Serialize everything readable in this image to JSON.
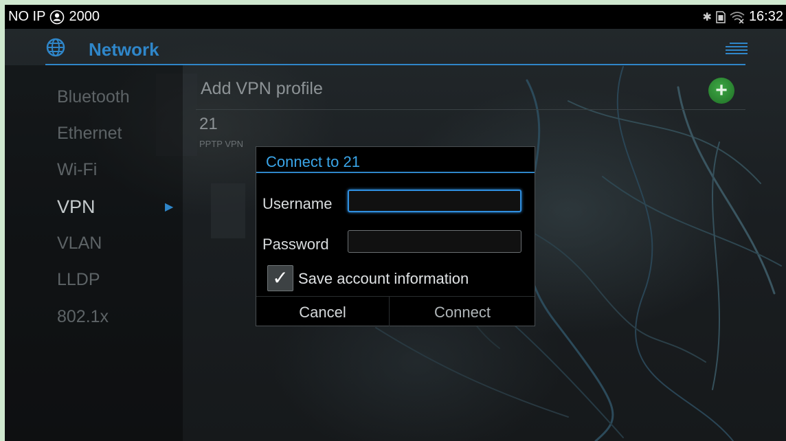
{
  "status_bar": {
    "ip_label": "NO IP",
    "account_number": "2000",
    "time": "16:32",
    "icons": [
      "person-circle-icon",
      "bluetooth-icon",
      "sim-icon",
      "wifi-off-icon"
    ]
  },
  "header": {
    "title": "Network",
    "logo_icon": "network-globe-icon",
    "menu_icon": "menu-icon",
    "accent_color": "#2f86c9"
  },
  "sidebar": {
    "items": [
      {
        "label": "Bluetooth"
      },
      {
        "label": "Ethernet"
      },
      {
        "label": "Wi-Fi"
      },
      {
        "label": "VPN",
        "active": true
      },
      {
        "label": "VLAN"
      },
      {
        "label": "LLDP"
      },
      {
        "label": "802.1x"
      }
    ],
    "active_arrow": "▶"
  },
  "content": {
    "add_vpn_label": "Add VPN profile",
    "add_button_icon": "plus-icon",
    "add_button_symbol": "+",
    "vpn_profiles": [
      {
        "name": "21",
        "type": "PPTP VPN"
      }
    ]
  },
  "dialog": {
    "title": "Connect to 21",
    "username_label": "Username",
    "username_value": "",
    "password_label": "Password",
    "password_value": "",
    "save_checkbox_checked": true,
    "save_label": "Save account information",
    "check_symbol": "✓",
    "cancel_label": "Cancel",
    "connect_label": "Connect"
  }
}
